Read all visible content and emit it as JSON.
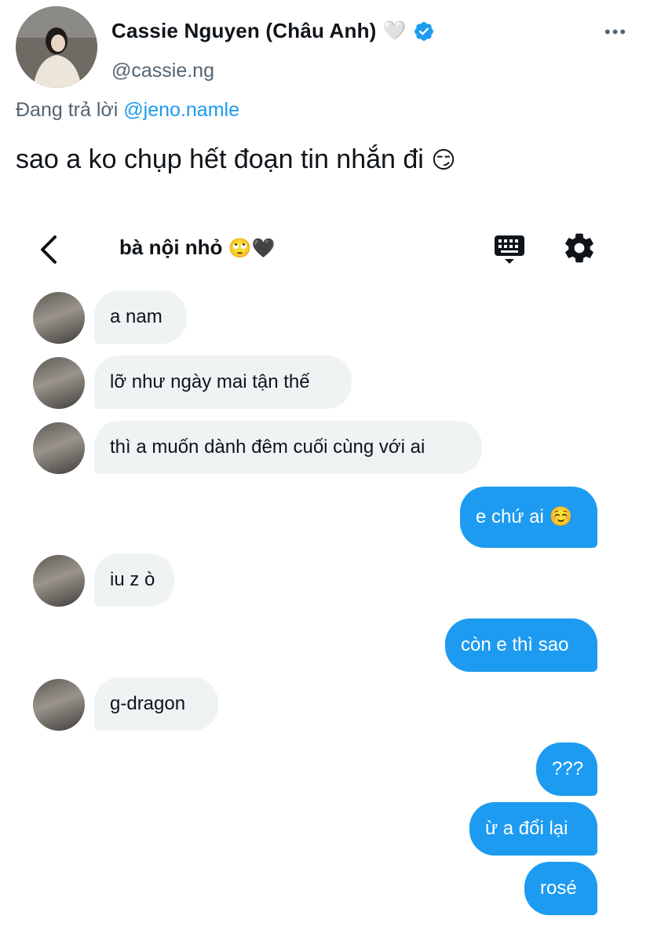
{
  "tweet": {
    "author_name": "Cassie Nguyen (Châu Anh)",
    "name_emoji": "🤍",
    "handle": "@cassie.ng",
    "more": "•••",
    "reply_prefix": "Đang trả lời",
    "reply_to": "@jeno.namle",
    "text": "sao a ko chụp hết đoạn tin nhắn đi",
    "text_emoji": "😏",
    "colors": {
      "accent": "#1d9bf0",
      "muted": "#536471",
      "text": "#0f1419"
    }
  },
  "chat": {
    "title": "bà nội nhỏ",
    "title_emojis": "🙄🖤",
    "icons": [
      "back-arrow-icon",
      "keyboard-icon",
      "gear-icon"
    ],
    "messages": [
      {
        "from": "them",
        "text": "a nam"
      },
      {
        "from": "them",
        "text": "lỡ như ngày mai tận thế"
      },
      {
        "from": "them",
        "text": "thì a muốn dành đêm cuối cùng với ai"
      },
      {
        "from": "me",
        "text": "e chứ ai ☺️"
      },
      {
        "from": "them",
        "text": "iu z ò"
      },
      {
        "from": "me",
        "text": "còn e thì sao"
      },
      {
        "from": "them",
        "text": "g-dragon"
      },
      {
        "from": "me",
        "text": "???"
      },
      {
        "from": "me",
        "text": "ừ a đổi lại"
      },
      {
        "from": "me",
        "text": "rosé"
      }
    ],
    "colors": {
      "incoming": "#eff3f4",
      "outgoing": "#1d9bf0"
    }
  }
}
